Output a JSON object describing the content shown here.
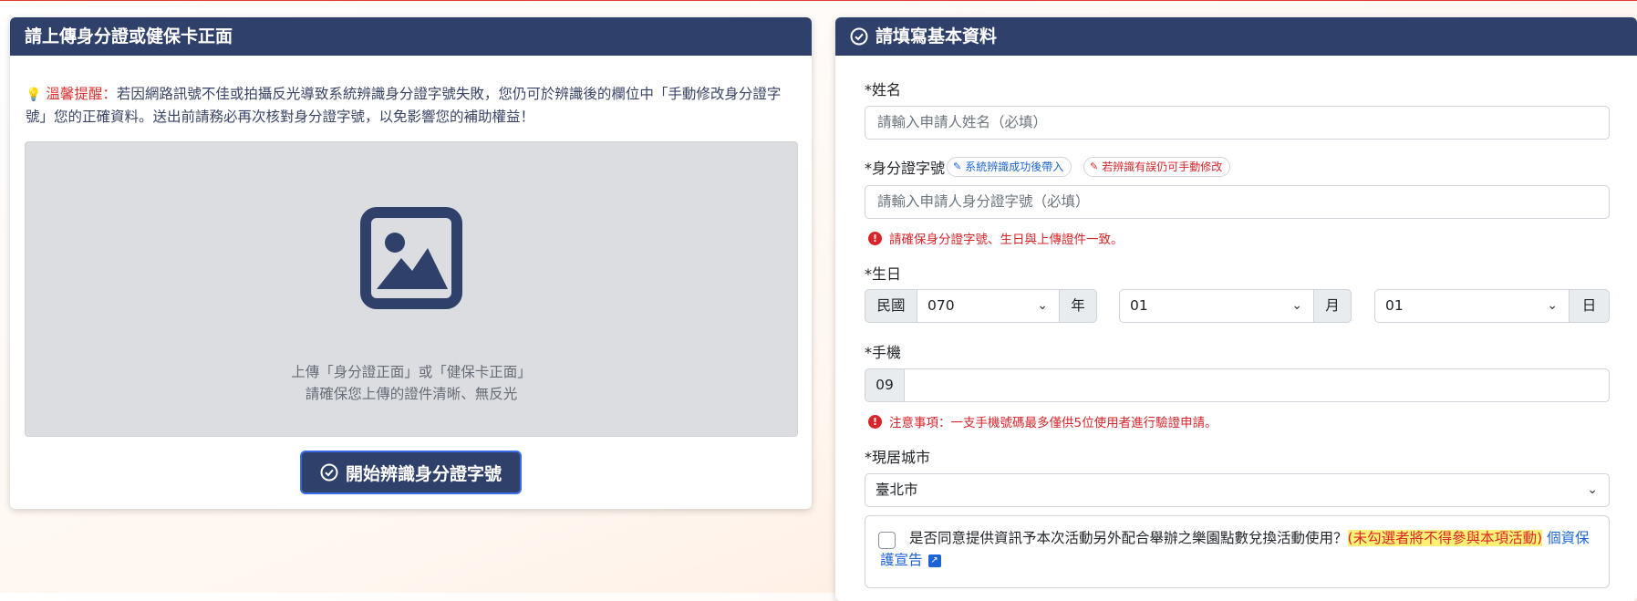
{
  "left": {
    "title": "請上傳身分證或健保卡正面",
    "tip_label": "溫馨提醒：",
    "tip_text": "若因網路訊號不佳或拍攝反光導致系統辨識身分證字號失敗，您仍可於辨識後的欄位中「手動修改身分證字號」您的正確資料。送出前請務必再次核對身分證字號，以免影響您的補助權益！",
    "upload_line1": "上傳「身分證正面」或「健保卡正面」",
    "upload_line2": "請確保您上傳的證件清晰、無反光",
    "recognize_button": "開始辨識身分證字號"
  },
  "right": {
    "title": "請填寫基本資料",
    "name_label": "*姓名",
    "name_placeholder": "請輸入申請人姓名（必填）",
    "id_label": "*身分證字號",
    "badge_auto": "系統辨識成功後帶入",
    "badge_manual": "若辨識有誤仍可手動修改",
    "id_placeholder": "請輸入申請人身分證字號（必填）",
    "id_error": "請確保身分證字號、生日與上傳證件一致。",
    "birthday_label": "*生日",
    "era_prefix": "民國",
    "year_value": "070",
    "year_suffix": "年",
    "month_value": "01",
    "month_suffix": "月",
    "day_value": "01",
    "day_suffix": "日",
    "phone_label": "*手機",
    "phone_prefix": "09",
    "phone_value": "",
    "phone_note": "注意事項：一支手機號碼最多僅供5位使用者進行驗證申請。",
    "city_label": "*現居城市",
    "city_value": "臺北市",
    "consent_text": "是否同意提供資訊予本次活動另外配合舉辦之樂園點數兌換活動使用？",
    "consent_warning": "(未勾選者將不得參與本項活動)",
    "consent_link": "個資保護宣告"
  },
  "colors": {
    "header_bg": "#2f416b",
    "accent_red": "#d6262b",
    "link_blue": "#1c63d6",
    "highlight_yellow": "#fff176"
  },
  "icons": {
    "tip": "lightbulb-icon",
    "upload": "image-icon",
    "check": "check-circle-icon",
    "wand": "magic-wand-icon",
    "edit": "edit-icon",
    "error": "exclamation-circle-icon",
    "chevron": "chevron-down-icon",
    "external": "external-link-icon"
  }
}
